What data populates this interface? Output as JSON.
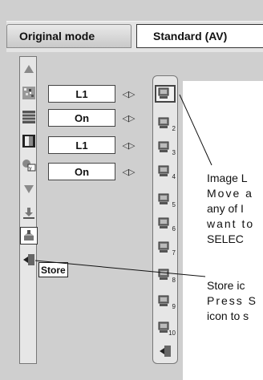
{
  "tabs": {
    "mode_label": "Original mode",
    "value_label": "Standard (AV)"
  },
  "left_icons": [
    "up-arrow-icon",
    "image-noise-icon",
    "stripes-icon",
    "contrast-icon",
    "gamma-icon",
    "down-arrow-icon",
    "download-icon",
    "store-icon",
    "exit-icon"
  ],
  "store_label": "Store",
  "values": [
    "L1",
    "On",
    "L1",
    "On"
  ],
  "adjust_arrows": "◁▷",
  "memory_slots": [
    {
      "icon": "image-level-icon",
      "num": ""
    },
    {
      "icon": "image-level-icon",
      "num": "2"
    },
    {
      "icon": "image-level-icon",
      "num": "3"
    },
    {
      "icon": "image-level-icon",
      "num": "4"
    },
    {
      "icon": "image-level-icon",
      "num": "5"
    },
    {
      "icon": "image-level-icon",
      "num": "6"
    },
    {
      "icon": "image-level-icon",
      "num": "7"
    },
    {
      "icon": "image-level-icon",
      "num": "8"
    },
    {
      "icon": "image-level-icon",
      "num": "9"
    },
    {
      "icon": "image-level-icon",
      "num": "10"
    }
  ],
  "exit_slot_icon": "exit-icon",
  "callouts": {
    "image_level": [
      "Image L",
      "Move a",
      "any of I",
      "want to",
      "SELEC"
    ],
    "store": [
      "Store ic",
      "Press S",
      "icon to s"
    ]
  }
}
